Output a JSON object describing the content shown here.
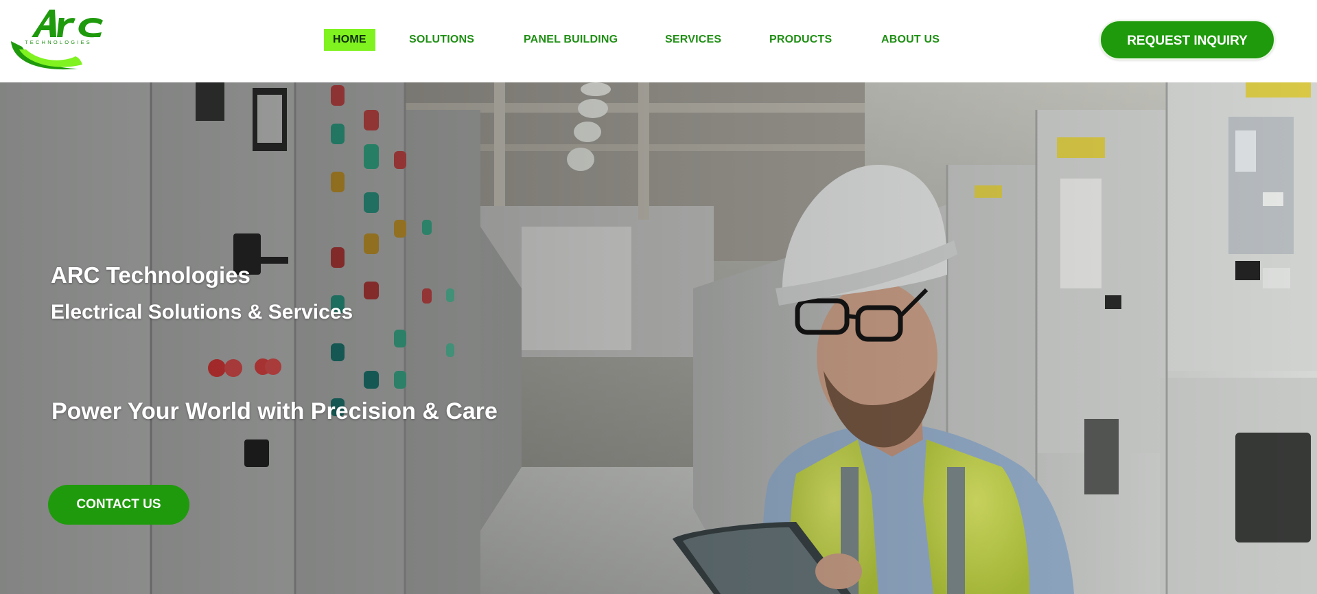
{
  "brand": {
    "logo_text": "ARC",
    "logo_subtext": "TECHNOLOGIES",
    "colors": {
      "primary": "#1f9a0c",
      "accent": "#7ff21f",
      "nav_text": "#1f8f14"
    }
  },
  "nav": {
    "items": [
      {
        "label": "HOME",
        "active": true
      },
      {
        "label": "SOLUTIONS",
        "active": false
      },
      {
        "label": "PANEL BUILDING",
        "active": false
      },
      {
        "label": "SERVICES",
        "active": false
      },
      {
        "label": "PRODUCTS",
        "active": false
      },
      {
        "label": "ABOUT US",
        "active": false
      }
    ],
    "cta_label": "REQUEST INQUIRY"
  },
  "hero": {
    "title": "ARC Technologies",
    "subtitle": "Electrical Solutions & Services",
    "tagline": "Power Your World with Precision & Care",
    "cta_label": "CONTACT US",
    "image_description_icon": "technician-with-tablet-image"
  }
}
